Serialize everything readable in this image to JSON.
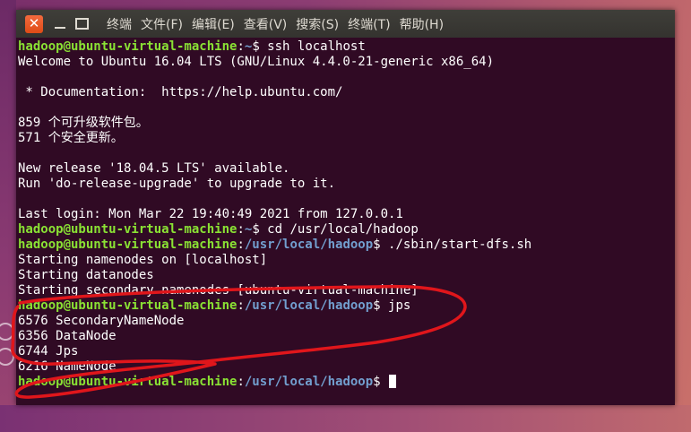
{
  "menubar": {
    "close_glyph": "✕",
    "items": [
      "终端",
      "文件(F)",
      "编辑(E)",
      "查看(V)",
      "搜索(S)",
      "终端(T)",
      "帮助(H)"
    ]
  },
  "terminal": {
    "lines": [
      {
        "user": "hadoop@ubuntu-virtual-machine",
        "sep": ":",
        "path": "~",
        "prompt": "$ ",
        "cmd": "ssh localhost"
      },
      {
        "text": "Welcome to Ubuntu 16.04 LTS (GNU/Linux 4.4.0-21-generic x86_64)"
      },
      {
        "text": ""
      },
      {
        "text": " * Documentation:  https://help.ubuntu.com/"
      },
      {
        "text": ""
      },
      {
        "text": "859 个可升级软件包。"
      },
      {
        "text": "571 个安全更新。"
      },
      {
        "text": ""
      },
      {
        "text": "New release '18.04.5 LTS' available."
      },
      {
        "text": "Run 'do-release-upgrade' to upgrade to it."
      },
      {
        "text": ""
      },
      {
        "text": "Last login: Mon Mar 22 19:40:49 2021 from 127.0.0.1"
      },
      {
        "user": "hadoop@ubuntu-virtual-machine",
        "sep": ":",
        "path": "~",
        "prompt": "$ ",
        "cmd": "cd /usr/local/hadoop"
      },
      {
        "user": "hadoop@ubuntu-virtual-machine",
        "sep": ":",
        "path": "/usr/local/hadoop",
        "prompt": "$ ",
        "cmd": "./sbin/start-dfs.sh"
      },
      {
        "text": "Starting namenodes on [localhost]"
      },
      {
        "text": "Starting datanodes"
      },
      {
        "text": "Starting secondary namenodes [ubuntu-virtual-machine]"
      },
      {
        "user": "hadoop@ubuntu-virtual-machine",
        "sep": ":",
        "path": "/usr/local/hadoop",
        "prompt": "$ ",
        "cmd": "jps"
      },
      {
        "text": "6576 SecondaryNameNode"
      },
      {
        "text": "6356 DataNode"
      },
      {
        "text": "6744 Jps"
      },
      {
        "text": "6216 NameNode"
      },
      {
        "user": "hadoop@ubuntu-virtual-machine",
        "sep": ":",
        "path": "/usr/local/hadoop",
        "prompt": "$ ",
        "cmd": "",
        "cursor": true
      }
    ]
  },
  "colors": {
    "terminal_bg": "#300a24",
    "user": "#8ae234",
    "path": "#729fcf",
    "annotation": "#e0161b"
  }
}
